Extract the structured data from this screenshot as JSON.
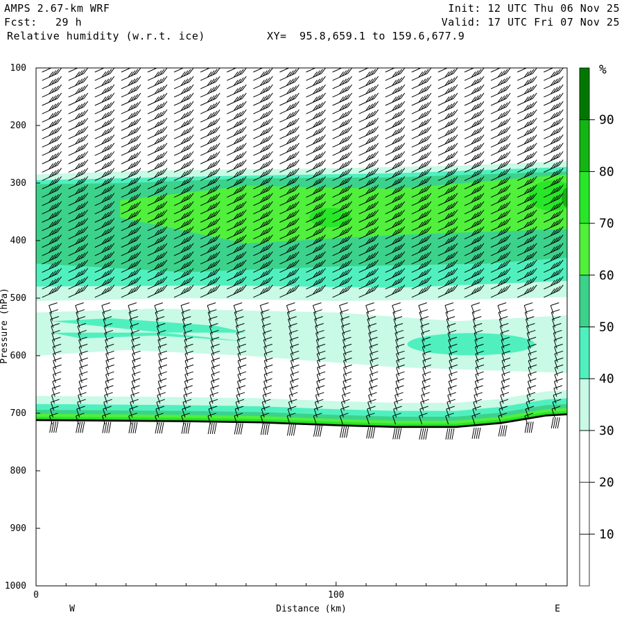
{
  "header": {
    "model": "AMPS 2.67-km WRF",
    "forecast_label": "Fcst:",
    "forecast_value": "29 h",
    "field": "Relative humidity (w.r.t. ice)",
    "xy_label": "XY=",
    "xy_value": "95.8,659.1 to 159.6,677.9",
    "init": "Init: 12 UTC Thu 06 Nov 25",
    "valid": "Valid: 17 UTC Fri 07 Nov 25"
  },
  "chart_data": {
    "type": "heatmap",
    "title": "Relative humidity (w.r.t. ice)",
    "xlabel": "Distance (km)",
    "ylabel": "Pressure (hPa)",
    "x_ticks": [
      "0",
      "100"
    ],
    "x_tick_values": [
      0,
      100
    ],
    "xlim": [
      0,
      177
    ],
    "ylim": [
      1000,
      100
    ],
    "y_axis_inverted": true,
    "y_tick_values": [
      100,
      200,
      300,
      400,
      500,
      600,
      700,
      800,
      900,
      1000
    ],
    "y_ticks": [
      "100",
      "200",
      "300",
      "400",
      "500",
      "600",
      "700",
      "800",
      "900",
      "1000"
    ],
    "west_label": "W",
    "east_label": "E",
    "colorbar": {
      "unit": "%",
      "labels": [
        "10",
        "20",
        "30",
        "40",
        "50",
        "60",
        "70",
        "80",
        "90"
      ],
      "levels": [
        0,
        10,
        20,
        30,
        40,
        50,
        60,
        70,
        80,
        90,
        100
      ],
      "colors": [
        "#ffffff",
        "#ffffff",
        "#ffffff",
        "#c8fae6",
        "#50f0be",
        "#3cd28c",
        "#50f03c",
        "#28e628",
        "#14b414",
        "#007800"
      ]
    },
    "terrain_surface_hPa": [
      [
        0,
        712
      ],
      [
        25,
        713
      ],
      [
        50,
        714
      ],
      [
        75,
        716
      ],
      [
        100,
        721
      ],
      [
        120,
        724
      ],
      [
        140,
        724
      ],
      [
        155,
        717
      ],
      [
        170,
        704
      ],
      [
        177,
        702
      ]
    ],
    "rh_layers": [
      {
        "name": "upper moist layer",
        "level": "30-40",
        "top_hPa": 275,
        "bottom_hPa": 505
      },
      {
        "name": "upper moist core",
        "level": "50-60",
        "top_hPa": 295,
        "bottom_hPa": 440
      },
      {
        "name": "upper maximum",
        "level": "60-70",
        "center_km": 98,
        "center_hPa": 360
      },
      {
        "name": "east maximum",
        "level": "70-80",
        "center_km": 175,
        "center_hPa": 325
      },
      {
        "name": "mid-level band",
        "level": "30-40",
        "top_hPa": 520,
        "bottom_hPa": 630
      },
      {
        "name": "mid-level patch",
        "level": "40-50",
        "center_km": 145,
        "center_hPa": 580
      },
      {
        "name": "near-surface layer",
        "level": "30-90",
        "top_hPa": 672,
        "bottom_hPa": 712
      }
    ],
    "wind_barbs": "westerly flow throughout the column"
  }
}
